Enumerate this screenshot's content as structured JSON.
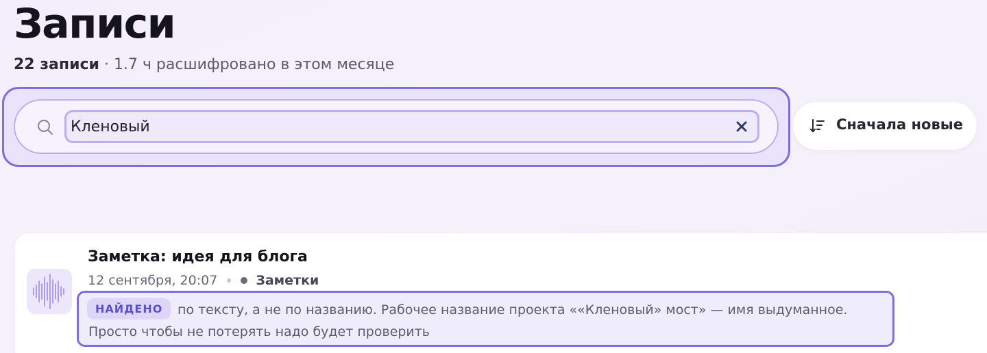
{
  "header": {
    "title": "Записи",
    "count": "22 записи",
    "stats": " · 1.7 ч расшифровано в этом месяце"
  },
  "search": {
    "value": "Кленовый",
    "placeholder": "",
    "search_icon": "search-icon",
    "clear_icon": "close-icon"
  },
  "sort": {
    "label": "Сначала новые",
    "icon": "sort-descending-icon"
  },
  "records": [
    {
      "title": "Заметка: идея для блога",
      "date": "12 сентября, 20:07",
      "category": "Заметки",
      "thumbnail_icon": "waveform-icon",
      "match_badge": "НАЙДЕНО",
      "snippet": "по тексту, а не по названию. Рабочее название проекта ««Кленовый» мост» — имя выдуманное. Просто чтобы не потерять надо будет проверить"
    }
  ],
  "colors": {
    "accent": "#7c6fd8",
    "accent_light": "#b9b0ee",
    "badge_bg": "#ddd6f8",
    "badge_text": "#5d4fc5",
    "background": "#f4f0fb"
  }
}
